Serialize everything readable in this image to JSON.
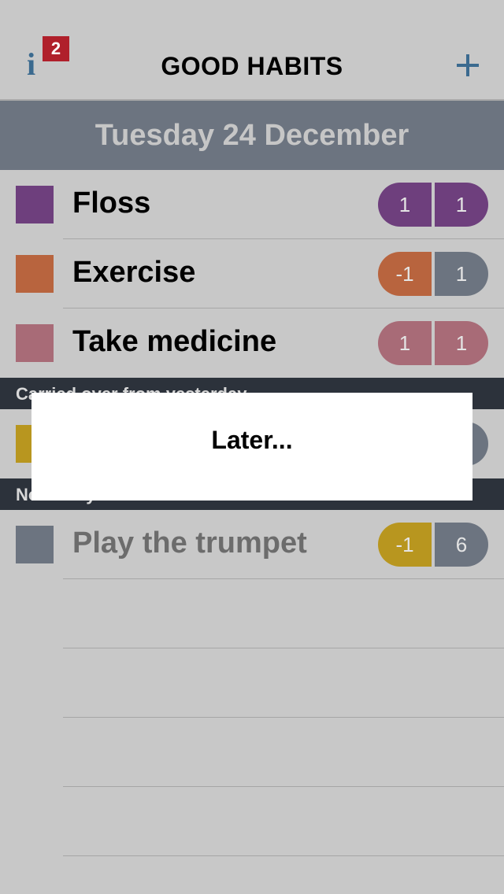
{
  "navbar": {
    "info_icon": "i",
    "badge_count": "2",
    "title": "GOOD HABITS",
    "add_icon": "plus-icon"
  },
  "date_header": "Tuesday 24 December",
  "today": [
    {
      "label": "Floss",
      "color": "#6e3f7d",
      "left_value": "1",
      "right_value": "1",
      "left_color": "#6e3f7d",
      "right_color": "#6e3f7d"
    },
    {
      "label": "Exercise",
      "color": "#b8643e",
      "left_value": "-1",
      "right_value": "1",
      "left_color": "#b8643e",
      "right_color": "#6c7480"
    },
    {
      "label": "Take medicine",
      "color": "#a86b77",
      "left_value": "1",
      "right_value": "1",
      "left_color": "#a86b77",
      "right_color": "#a86b77"
    }
  ],
  "section_carried": "Carried over from yesterday",
  "carried_row": {
    "color": "#b8961f"
  },
  "section_not_today": "Not today",
  "not_today": [
    {
      "label": "Play the trumpet",
      "color": "#6c7480",
      "left_value": "-1",
      "right_value": "6",
      "left_color": "#b8961f",
      "right_color": "#6c7480"
    }
  ],
  "modal": {
    "text": "Later..."
  }
}
